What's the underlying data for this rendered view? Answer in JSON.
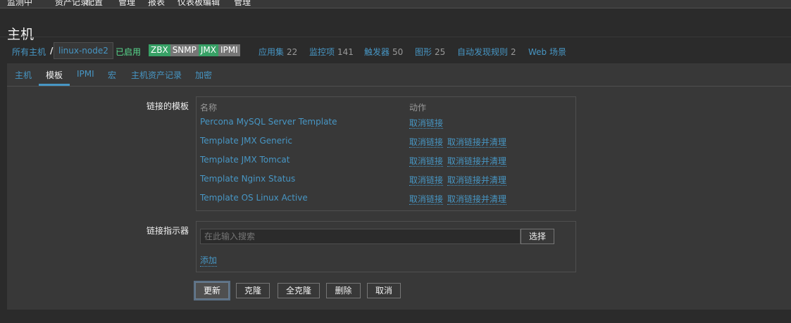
{
  "topnav": {
    "items": [
      "监测中",
      "资产记录",
      "配置",
      "管理",
      "报表",
      "仪表板编辑",
      "管理"
    ]
  },
  "page": {
    "title": "主机"
  },
  "hostnav": {
    "all_hosts": "所有主机",
    "separator": "/",
    "current_host": "linux-node2",
    "status": "已启用",
    "badges": [
      {
        "label": "ZBX",
        "color": "#38a166"
      },
      {
        "label": "SNMP",
        "color": "#767676"
      },
      {
        "label": "JMX",
        "color": "#38a166"
      },
      {
        "label": "IPMI",
        "color": "#767676"
      }
    ],
    "links": [
      {
        "label": "应用集",
        "count": "22"
      },
      {
        "label": "监控项",
        "count": "141"
      },
      {
        "label": "触发器",
        "count": "50"
      },
      {
        "label": "图形",
        "count": "25"
      },
      {
        "label": "自动发现规则",
        "count": "2"
      },
      {
        "label": "Web 场景",
        "count": ""
      }
    ]
  },
  "tabs": [
    {
      "label": "主机",
      "active": false
    },
    {
      "label": "模板",
      "active": true
    },
    {
      "label": "IPMI",
      "active": false
    },
    {
      "label": "宏",
      "active": false
    },
    {
      "label": "主机资产记录",
      "active": false
    },
    {
      "label": "加密",
      "active": false
    }
  ],
  "linked_templates": {
    "label": "链接的模板",
    "col_name": "名称",
    "col_action": "动作",
    "rows": [
      {
        "name": "Percona MySQL Server Template",
        "unlink": "取消链接",
        "unlink_clear": ""
      },
      {
        "name": "Template JMX Generic",
        "unlink": "取消链接",
        "unlink_clear": "取消链接并清理"
      },
      {
        "name": "Template JMX Tomcat",
        "unlink": "取消链接",
        "unlink_clear": "取消链接并清理"
      },
      {
        "name": "Template Nginx Status",
        "unlink": "取消链接",
        "unlink_clear": "取消链接并清理"
      },
      {
        "name": "Template OS Linux Active",
        "unlink": "取消链接",
        "unlink_clear": "取消链接并清理"
      }
    ]
  },
  "link_new": {
    "label": "链接指示器",
    "search_placeholder": "在此输入搜索",
    "search_value": "",
    "select_button": "选择",
    "add_link": "添加"
  },
  "actions": {
    "update": "更新",
    "clone": "克隆",
    "full_clone": "全克隆",
    "delete": "删除",
    "cancel": "取消"
  }
}
